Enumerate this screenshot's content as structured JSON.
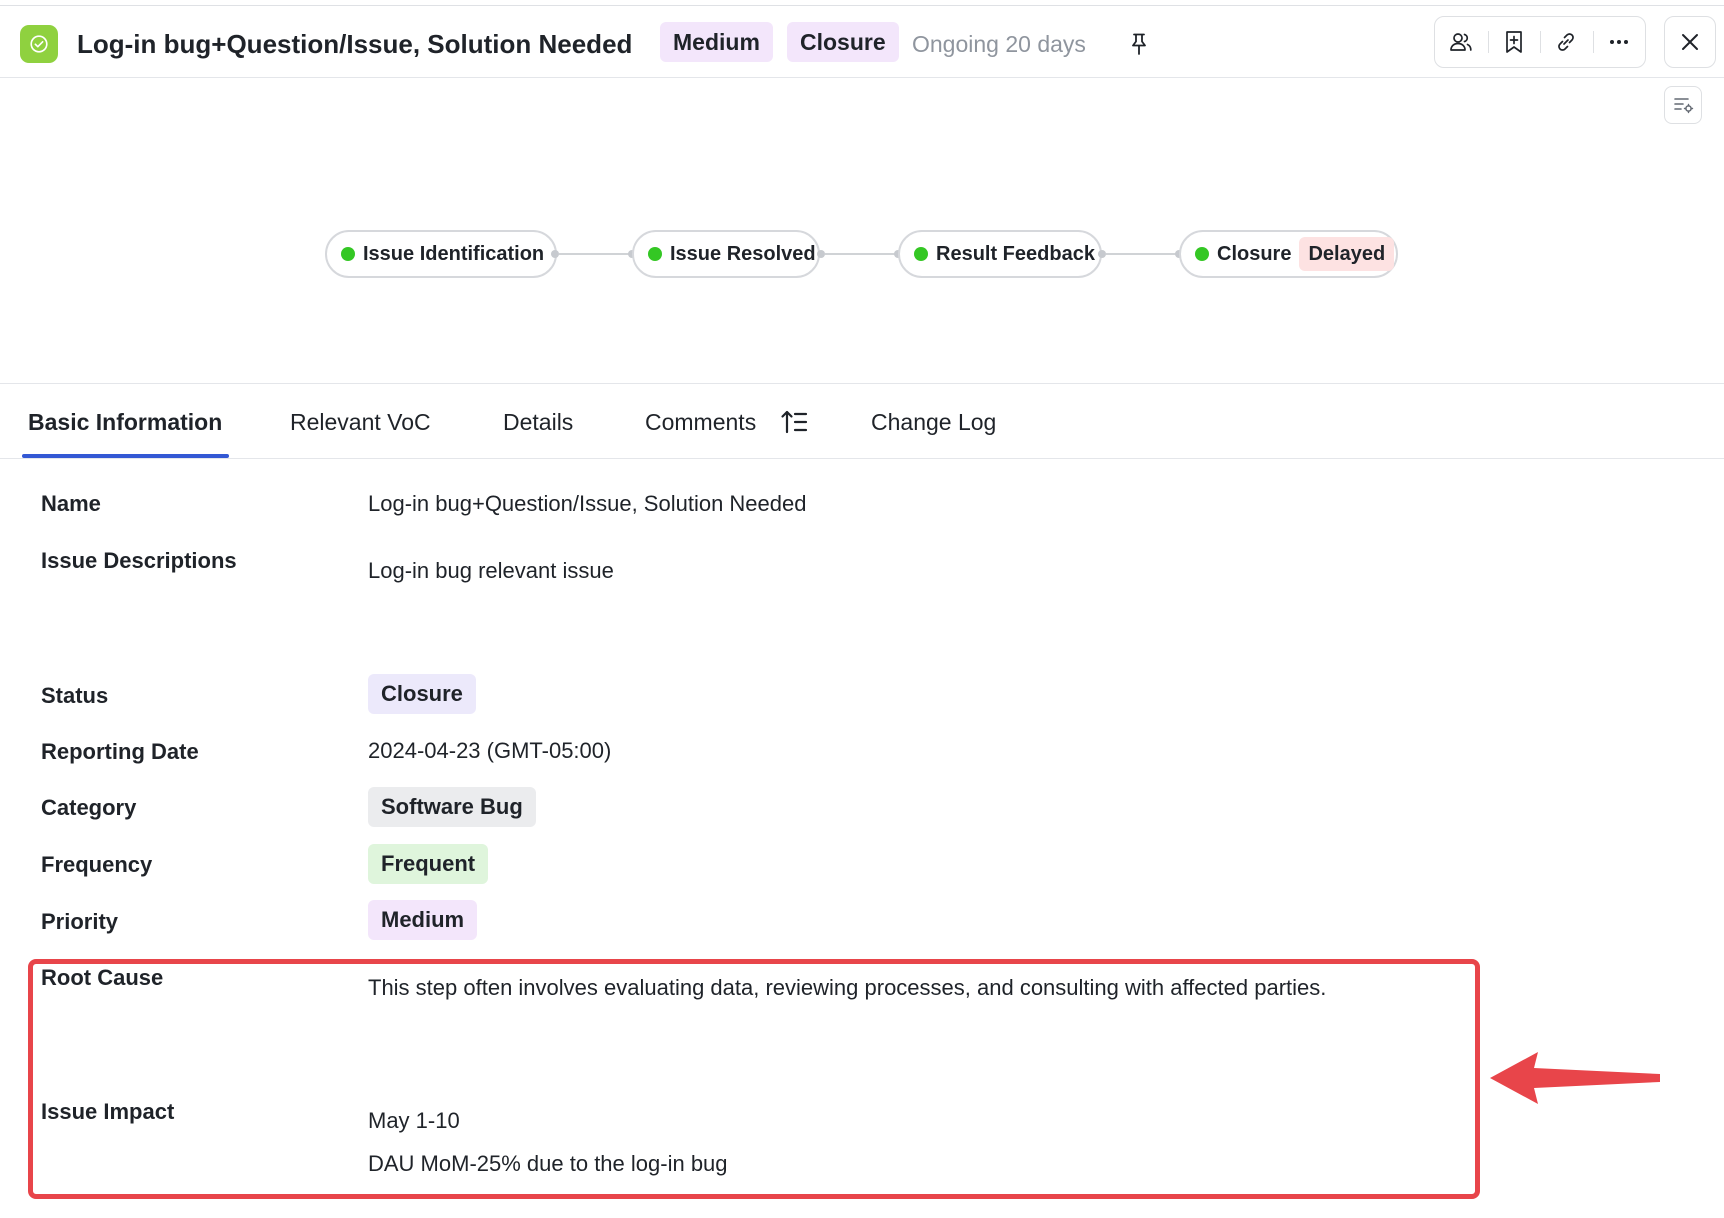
{
  "header": {
    "title": "Log-in bug+Question/Issue, Solution Needed",
    "priority_tag": "Medium",
    "status_tag": "Closure",
    "ongoing": "Ongoing 20 days"
  },
  "flow": {
    "stages": [
      {
        "label": "Issue Identification"
      },
      {
        "label": "Issue Resolved"
      },
      {
        "label": "Result Feedback"
      },
      {
        "label": "Closure",
        "badge": "Delayed"
      }
    ]
  },
  "tabs": [
    "Basic Information",
    "Relevant VoC",
    "Details",
    "Comments",
    "Change Log"
  ],
  "fields": {
    "name": {
      "label": "Name",
      "value": "Log-in bug+Question/Issue, Solution Needed"
    },
    "descriptions": {
      "label": "Issue Descriptions",
      "value": "Log-in bug relevant issue"
    },
    "status": {
      "label": "Status",
      "value": "Closure"
    },
    "reporting_date": {
      "label": "Reporting Date",
      "value": "2024-04-23 (GMT-05:00)"
    },
    "category": {
      "label": "Category",
      "value": "Software Bug"
    },
    "frequency": {
      "label": "Frequency",
      "value": "Frequent"
    },
    "priority": {
      "label": "Priority",
      "value": "Medium"
    },
    "root_cause": {
      "label": "Root Cause",
      "value": "This step often involves evaluating data, reviewing processes, and consulting with affected parties."
    },
    "issue_impact": {
      "label": "Issue Impact",
      "lines": [
        "May 1-10",
        "DAU MoM-25% due to the log-in bug"
      ]
    }
  },
  "colors": {
    "accent": "#3358d4",
    "stage_dot": "#34c724",
    "app_icon": "#8fd13f",
    "highlight": "#e8454a",
    "tag_purple": "#f3e6fb",
    "tag_red": "#fde2e2",
    "tag_green": "#dff5dc"
  },
  "icons": {
    "app": "check-circle-icon",
    "pin": "pin-icon",
    "toolbar": [
      "members-icon",
      "bookmark-add-icon",
      "link-icon",
      "more-icon"
    ],
    "close": "close-icon",
    "settings": "list-settings-icon",
    "comments_sort": "sort-icon",
    "annotation": "red-arrow-icon"
  }
}
